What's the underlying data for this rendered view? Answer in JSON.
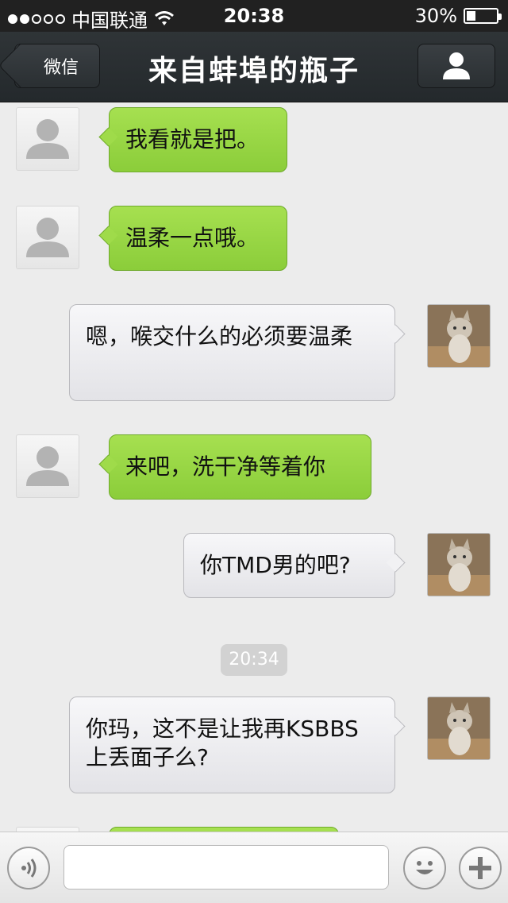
{
  "status_bar": {
    "carrier": "中国联通",
    "time": "20:38",
    "battery": "30%",
    "battery_level": 0.3,
    "signal_bars_filled": 2,
    "signal_bars_total": 5
  },
  "nav": {
    "back_label": "微信",
    "title": "来自蚌埠的瓶子",
    "profile_icon": "person-icon"
  },
  "messages": [
    {
      "side": "in",
      "text": "我看就是把。"
    },
    {
      "side": "in",
      "text": "温柔一点哦。"
    },
    {
      "side": "out",
      "text": "嗯，喉交什么的必须要温柔"
    },
    {
      "side": "in",
      "text": "来吧，洗干净等着你"
    },
    {
      "side": "out",
      "text": "你TMD男的吧?"
    },
    {
      "side": "out",
      "text": "你玛，这不是让我再KSBBS上丢面子么?"
    }
  ],
  "timestamp": "20:34",
  "toolbar": {
    "voice_icon": "voice-icon",
    "emoji_icon": "smiley-icon",
    "add_icon": "plus-icon",
    "input_value": ""
  },
  "colors": {
    "incoming_bubble": "#97d543",
    "outgoing_bubble": "#ececee",
    "nav_bar": "#2b3033"
  }
}
